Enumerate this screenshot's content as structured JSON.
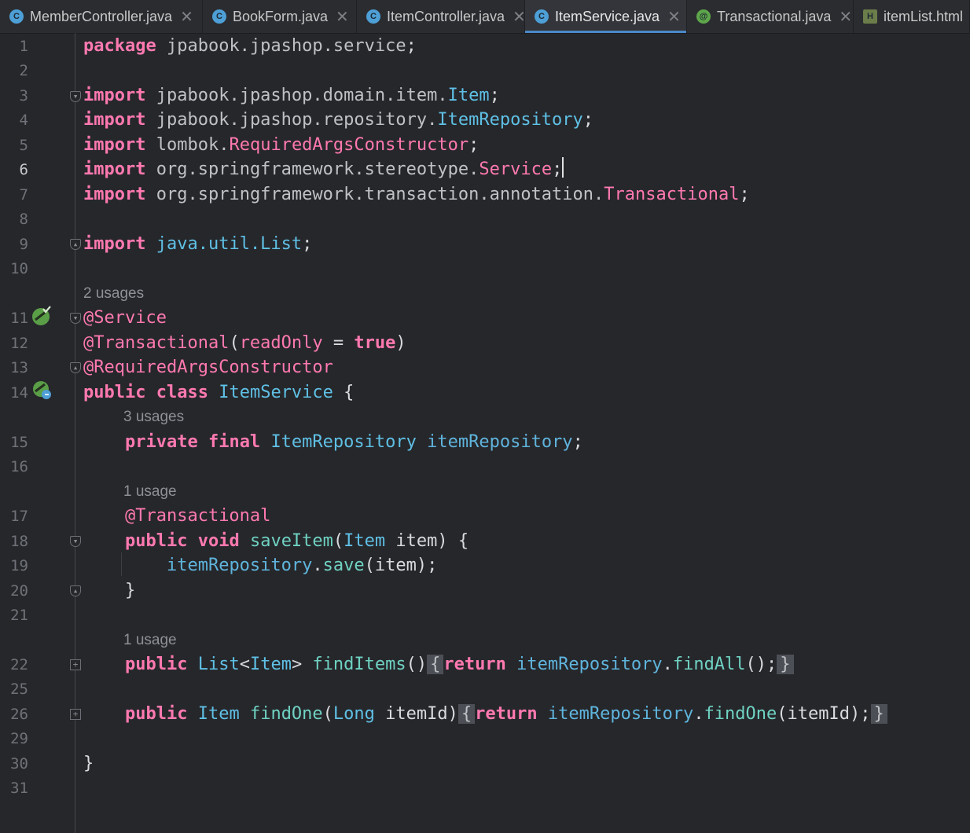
{
  "tabs": [
    {
      "label": "MemberController.java",
      "icon": "class-icon",
      "active": false,
      "close": "✕"
    },
    {
      "label": "BookForm.java",
      "icon": "class-icon",
      "active": false,
      "close": "✕"
    },
    {
      "label": "ItemController.java",
      "icon": "class-icon",
      "active": false,
      "close": "✕"
    },
    {
      "label": "ItemService.java",
      "icon": "class-icon",
      "active": true,
      "close": "✕"
    },
    {
      "label": "Transactional.java",
      "icon": "annotation-icon",
      "active": false,
      "close": "✕"
    },
    {
      "label": "itemList.html",
      "icon": "html-file-icon",
      "active": false,
      "close": ""
    }
  ],
  "icon_glyphs": {
    "class-icon": "C",
    "annotation-icon": "@",
    "html-file-icon": "H"
  },
  "colors": {
    "class_icon": "#4d9fd6",
    "annotation_icon": "#5ea64b",
    "html_icon": "#6b7d4a",
    "keyword": "#ff79b0",
    "type": "#5fc0e5",
    "function": "#6fd2c2",
    "field": "#5fb4dc",
    "active_tab_underline": "#4a88c7"
  },
  "current_line": "6",
  "line_numbers": [
    "1",
    "2",
    "3",
    "4",
    "5",
    "6",
    "7",
    "8",
    "9",
    "10",
    "11",
    "12",
    "13",
    "14",
    "15",
    "16",
    "17",
    "18",
    "19",
    "20",
    "21",
    "22",
    "25",
    "26",
    "29",
    "30",
    "31"
  ],
  "hints": {
    "service_usages": "2 usages",
    "repository_usages": "3 usages",
    "saveitem_usages": "1 usage",
    "finditems_usages": "1 usage"
  },
  "code": {
    "kw": {
      "package": "package",
      "import": "import",
      "public": "public",
      "class": "class",
      "private": "private",
      "final": "final",
      "void": "void",
      "return": "return",
      "true": "true"
    },
    "punct": {
      "semi": ";",
      "dot": ".",
      "lparen": "(",
      "rparen": ")",
      "lbrace": "{",
      "rbrace": "}",
      "eq": " = ",
      "lt": "<",
      "gt": ">",
      "empty_parens": "()",
      "fold_open": "{",
      "fold_close": "}",
      "paren_semi": "();",
      "rparen_semi": ");"
    },
    "line1_pkg": "jpabook.jpashop.service",
    "line3_pkg": "jpabook.jpashop.domain.item",
    "line3_cls": "Item",
    "line4_pkg": "jpabook.jpashop.repository",
    "line4_cls": "ItemRepository",
    "line5_pkg": "lombok",
    "line5_cls": "RequiredArgsConstructor",
    "line6_pkg": "org.springframework.stereotype",
    "line6_cls": "Service",
    "line7_pkg": "org.springframework.transaction.annotation",
    "line7_cls": "Transactional",
    "line9_import": "java.util.List",
    "ann_service": "@Service",
    "ann_transactional": "@Transactional",
    "param_readonly": "readOnly",
    "ann_required": "@RequiredArgsConstructor",
    "class_name": "ItemService",
    "repo_type": "ItemRepository",
    "repo_field": "itemRepository",
    "save_method": "saveItem",
    "item_type": "Item",
    "item_param": "item",
    "save_call": "save",
    "list_type": "List",
    "finditems_method": "findItems",
    "findall_call": "findAll",
    "findone_method": "findOne",
    "long_type": "Long",
    "itemid_param": "itemId"
  }
}
